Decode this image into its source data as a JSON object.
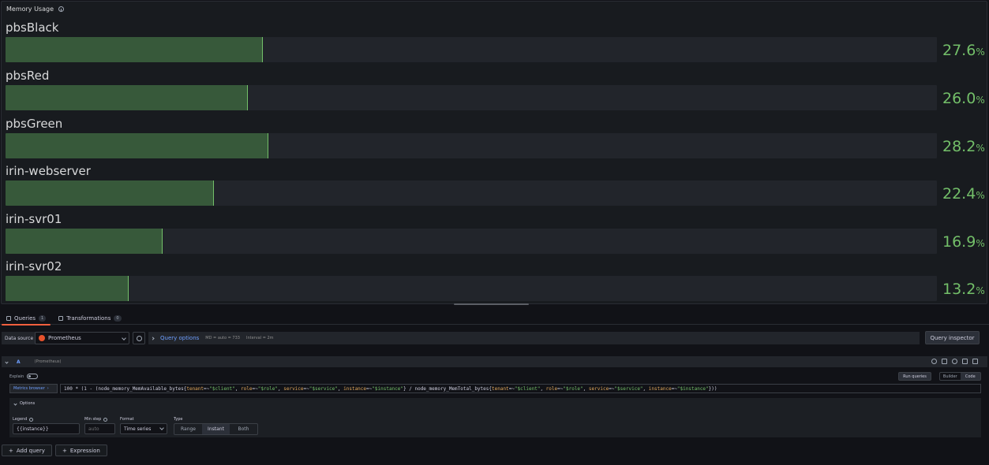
{
  "panel": {
    "title": "Memory Usage",
    "unit": "%",
    "colors": {
      "fill": "#37593a",
      "edge": "#73bf69",
      "value": "#73bf69"
    },
    "rows": [
      {
        "name": "pbsBlack",
        "value": "27.6",
        "percent": 27.6
      },
      {
        "name": "pbsRed",
        "value": "26.0",
        "percent": 26.0
      },
      {
        "name": "pbsGreen",
        "value": "28.2",
        "percent": 28.2
      },
      {
        "name": "irin-webserver",
        "value": "22.4",
        "percent": 22.4
      },
      {
        "name": "irin-svr01",
        "value": "16.9",
        "percent": 16.9
      },
      {
        "name": "irin-svr02",
        "value": "13.2",
        "percent": 13.2
      }
    ]
  },
  "tabs": {
    "queries": {
      "label": "Queries",
      "count": "1"
    },
    "transformations": {
      "label": "Transformations",
      "count": "0"
    }
  },
  "toolbar": {
    "datasource_label": "Data source",
    "datasource_value": "Prometheus",
    "query_options_label": "Query options",
    "md_text": "MD = auto = 733",
    "interval_text": "Interval = 2m",
    "query_inspector_label": "Query inspector"
  },
  "query": {
    "ref": "A",
    "datasource": "(Prometheus)",
    "explain_label": "Explain",
    "run_queries_label": "Run queries",
    "builder_label": "Builder",
    "code_label": "Code",
    "metrics_browser_label": "Metrics browser",
    "expr": {
      "p1": "100 * (1 - (node_memory_MemAvailable_bytes{",
      "l_tenant": "tenant",
      "op_tenant": "=~",
      "s_client": "\"$client\"",
      "c1": ", ",
      "l_role": "role",
      "op_role": "=~",
      "s_role": "\"$role\"",
      "c2": ", ",
      "l_service": "service",
      "op_service": "=~",
      "s_service": "\"$service\"",
      "c3": ", ",
      "l_instance": "instance",
      "op_instance": "=~",
      "s_instance": "\"$instance\"",
      "p2": "} / node_memory_MemTotal_bytes{",
      "l_tenant2": "tenant",
      "op_tenant2": "=~",
      "s_client2": "\"$client\"",
      "c4": ", ",
      "l_role2": "role",
      "op_role2": "=~",
      "s_role2": "\"$role\"",
      "c5": ", ",
      "l_service2": "service",
      "op_service2": "=~",
      "s_service2": "\"$service\"",
      "c6": ", ",
      "l_instance2": "instance",
      "op_instance2": "=~",
      "s_instance2": "\"$instance\"",
      "p3": "}))"
    },
    "options": {
      "header": "Options",
      "legend_label": "Legend",
      "legend_value": "{{instance}}",
      "minstep_label": "Min step",
      "minstep_placeholder": "auto",
      "format_label": "Format",
      "format_value": "Time series",
      "type_label": "Type",
      "type_options": [
        "Range",
        "Instant",
        "Both"
      ],
      "type_selected": "Instant"
    }
  },
  "bottom": {
    "add_query_label": "Add query",
    "expression_label": "Expression"
  }
}
